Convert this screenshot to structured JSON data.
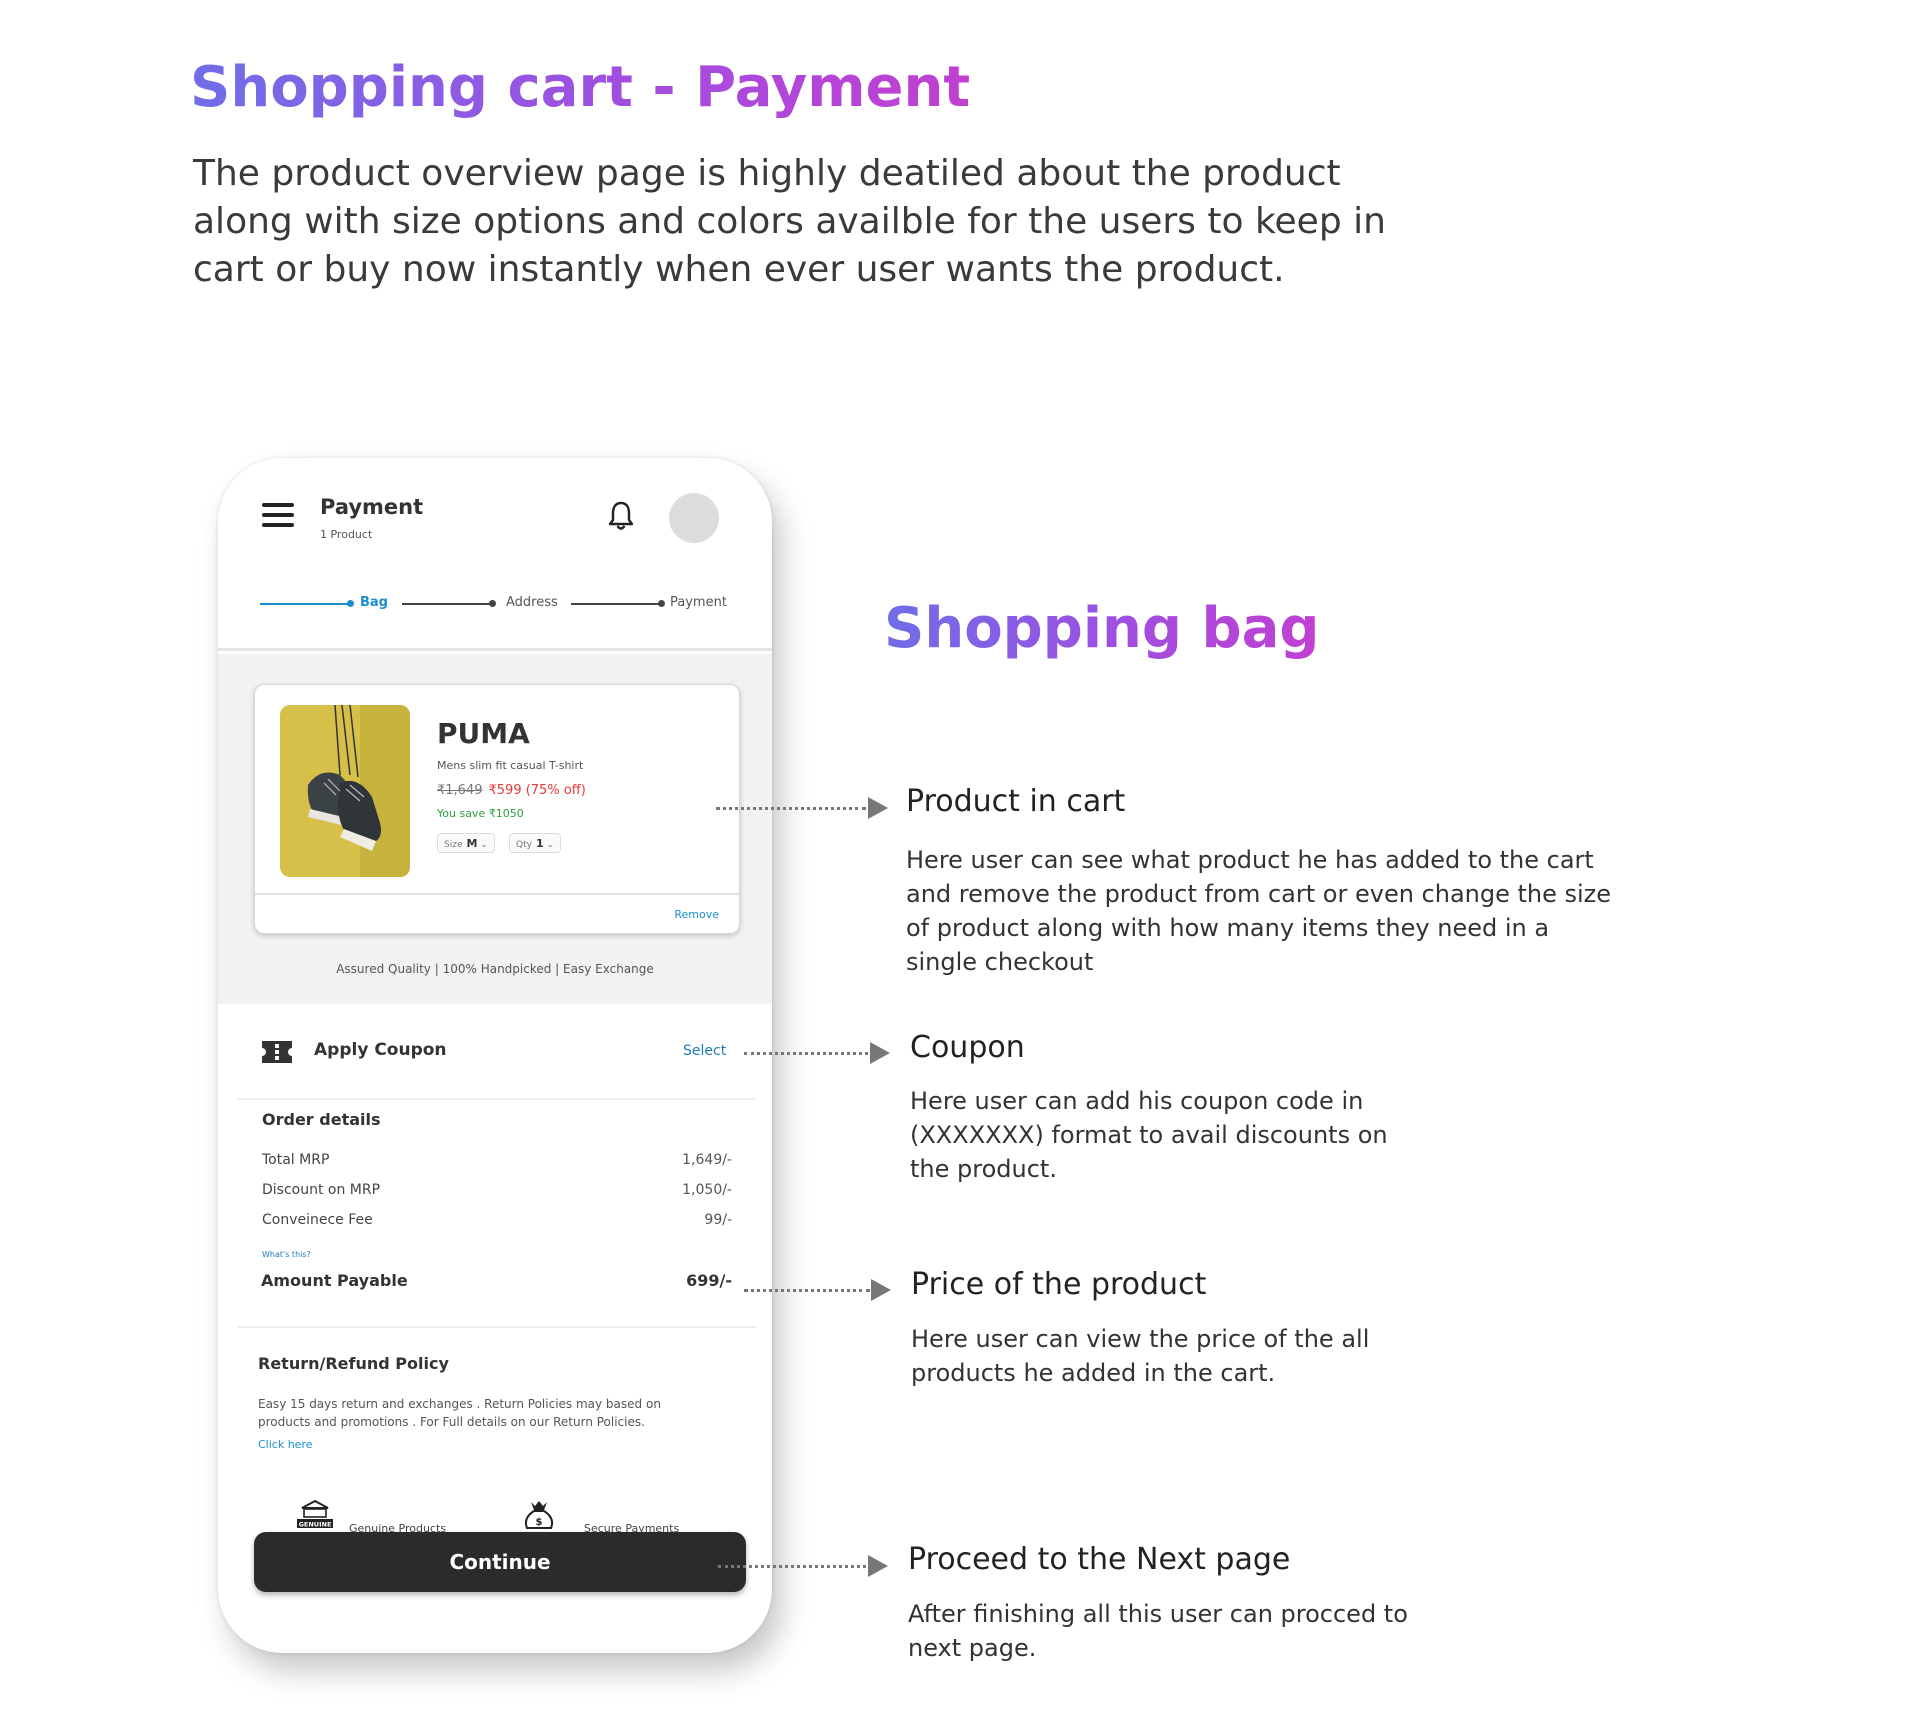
{
  "page": {
    "title": "Shopping cart - Payment",
    "intro": "The product overview page is highly deatiled about the product along with size options and colors availble for the users to keep in cart or buy now instantly when ever user wants the product.",
    "section_title": "Shopping bag"
  },
  "app": {
    "header": {
      "title": "Payment",
      "subtitle": "1 Product"
    },
    "steps": [
      {
        "label": "Bag",
        "active": true
      },
      {
        "label": "Address",
        "active": false
      },
      {
        "label": "Payment",
        "active": false
      }
    ],
    "product": {
      "brand": "PUMA",
      "name": "Mens slim fit casual T-shirt",
      "price_old": "₹1,649",
      "price_new": "₹599 (75% off)",
      "savings": "You save  ₹1050",
      "size_label": "Size",
      "size_value": "M",
      "qty_label": "Qty",
      "qty_value": "1",
      "remove_label": "Remove"
    },
    "assurance": "Assured Quality | 100% Handpicked | Easy Exchange",
    "coupon": {
      "label": "Apply Coupon",
      "action": "Select"
    },
    "order_details": {
      "title": "Order details",
      "rows": [
        {
          "label": "Total MRP",
          "value": "1,649/-"
        },
        {
          "label": "Discount on MRP",
          "value": "1,050/-"
        },
        {
          "label": "Conveinece Fee",
          "value": "99/-"
        }
      ],
      "whats_this": "What's this?",
      "amount_label": "Amount Payable",
      "amount_value": "699/-"
    },
    "policy": {
      "title": "Return/Refund Policy",
      "text": "Easy 15 days return and exchanges . Return Policies may based on products and promotions . For Full details on our Return Policies.",
      "link": "Click here"
    },
    "badges": [
      {
        "icon": "genuine-badge-icon",
        "icon_text": "GENUINE",
        "label": "Genuine Products"
      },
      {
        "icon": "money-bag-icon",
        "label": "Secure Payments"
      }
    ],
    "continue_label": "Continue"
  },
  "annotations": [
    {
      "title": "Product in cart",
      "body": "Here user can see what product he has added to the cart and remove the product from cart or even change the size of product along with how many items they need in a single checkout"
    },
    {
      "title": "Coupon",
      "body": "Here user can add his coupon code in (XXXXXXX) format to avail discounts on the product."
    },
    {
      "title": "Price of the product",
      "body": "Here user can view the price of the all products he added in the cart."
    },
    {
      "title": "Proceed to the Next page",
      "body": "After finishing all this user can procced to next page."
    }
  ],
  "colors": {
    "title_gradient": [
      "#6f6ee8",
      "#c23fd2"
    ],
    "accent": "#1a8fd0",
    "discount": "#e53935",
    "savings": "#2e9e3e",
    "button": "#2b2b2b"
  }
}
